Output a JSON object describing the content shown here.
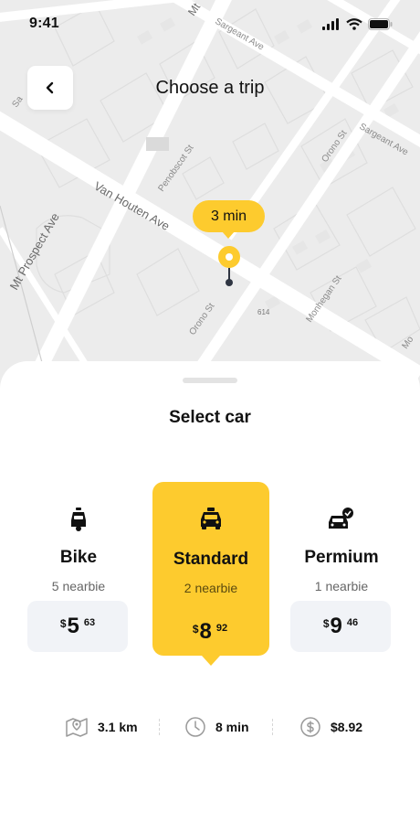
{
  "status_bar": {
    "time": "9:41"
  },
  "header": {
    "title": "Choose a trip"
  },
  "map": {
    "eta_label": "3 min",
    "street_labels": [
      "Mt",
      "Sargeant Ave",
      "Penobscot St",
      "Orono St",
      "Sargeant Ave",
      "Van Houten Ave",
      "Mt Prospect Ave",
      "Orono St",
      "614",
      "Monhegan St",
      "Sa",
      "Mo"
    ]
  },
  "sheet": {
    "title": "Select car",
    "options": [
      {
        "name": "Bike",
        "nearby": "5 nearbie",
        "currency": "$",
        "price_main": "5",
        "price_cents": "63",
        "icon": "scooter-icon",
        "selected": false
      },
      {
        "name": "Standard",
        "nearby": "2 nearbie",
        "currency": "$",
        "price_main": "8",
        "price_cents": "92",
        "icon": "taxi-icon",
        "selected": true
      },
      {
        "name": "Permium",
        "nearby": "1 nearbie",
        "currency": "$",
        "price_main": "9",
        "price_cents": "46",
        "icon": "premium-car-icon",
        "selected": false
      }
    ]
  },
  "trip_info": {
    "distance": "3.1 km",
    "duration": "8 min",
    "fare": "$8.92",
    "distance_icon": "map-icon",
    "duration_icon": "clock-icon",
    "fare_icon": "dollar-icon"
  },
  "colors": {
    "accent": "#FDCB2E",
    "map_bg": "#ECECEC",
    "price_bg": "#F1F3F7"
  }
}
